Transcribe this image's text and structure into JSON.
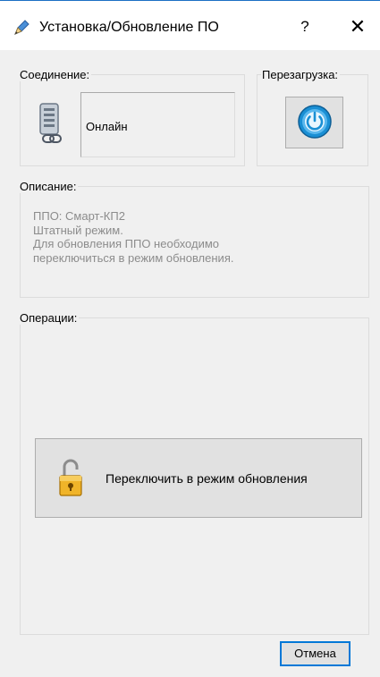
{
  "titlebar": {
    "title": "Установка/Обновление ПО",
    "help_label": "?",
    "close_label": "✕",
    "app_icon": "pen-icon"
  },
  "connection": {
    "label": "Соединение:",
    "status": "Онлайн",
    "icon": "server-link-icon"
  },
  "reboot": {
    "label": "Перезагрузка:",
    "icon": "power-icon"
  },
  "description": {
    "label": "Описание:",
    "line1": "ППО: Смарт-КП2",
    "line2": "Штатный режим.",
    "line3": "Для обновления ППО необходимо",
    "line4": "переключиться в режим обновления."
  },
  "operations": {
    "label": "Операции:",
    "switch_label": "Переключить в режим обновления",
    "icon": "padlock-open-icon"
  },
  "footer": {
    "cancel_label": "Отмена"
  },
  "colors": {
    "window_bg": "#f0f0f0",
    "accent": "#0078d7",
    "description_text": "#8c8c8c",
    "power_blue": "#1a8fd4",
    "lock_gold": "#e8a317"
  }
}
